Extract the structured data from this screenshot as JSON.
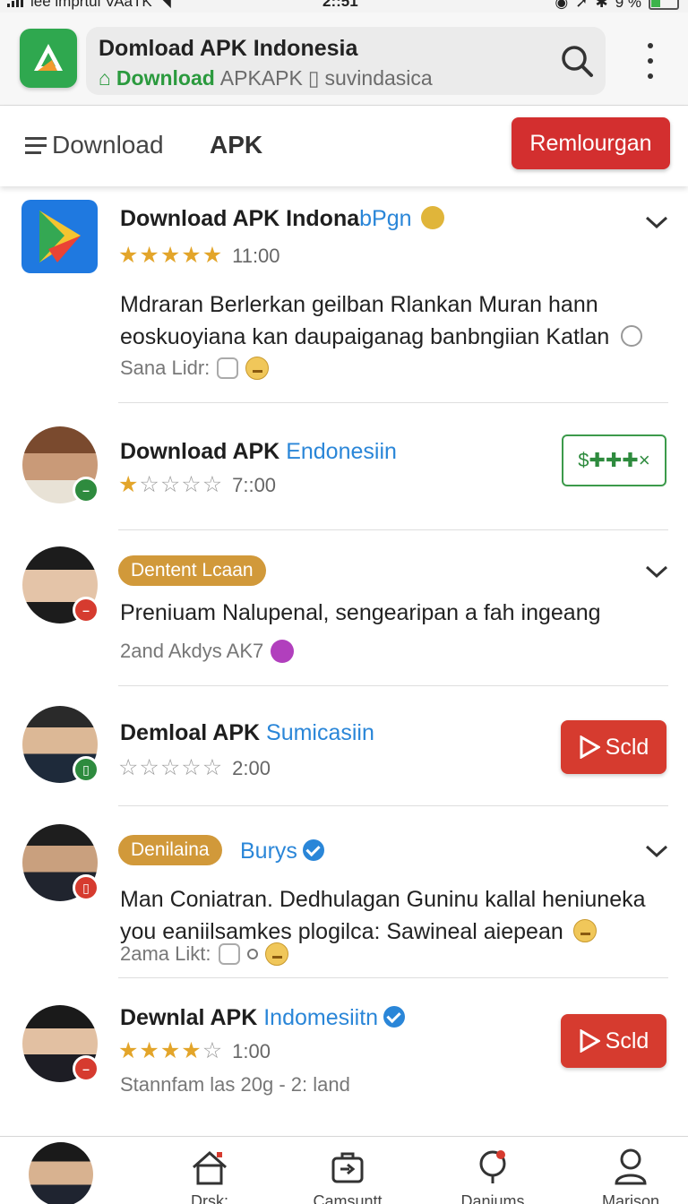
{
  "status": {
    "carrier": "lee imprtul VAaTK",
    "time": "2::51",
    "battery": "9 %"
  },
  "browser": {
    "title": "Domload APK Indonesia",
    "sub_green": "Download",
    "sub_rest": "APKAPK",
    "sub_domain": "suvindasica"
  },
  "topnav": {
    "download": "Download",
    "apk": "APK",
    "button": "Remlourgan"
  },
  "items": [
    {
      "name": "Download APK Indona",
      "name_blue": "bPgn",
      "rating": 5,
      "time": "11:00",
      "body": "Mdraran Berlerkan geilban Rlankan Muran hann eoskuoyiana kan daupaiganag banbngiian Katlan",
      "meta": "Sana Lidr:"
    },
    {
      "name": "Download APK",
      "name_blue": "Endonesiin",
      "rating": 1,
      "time": "7::00",
      "button": "$✚✚✚×"
    },
    {
      "tag": "Dentent Lcaan",
      "body": "Preniuam Nalupenal, sengearipan a fah ingeang",
      "meta": "2and Akdys  AK7"
    },
    {
      "name": "Demloal APK",
      "name_blue": "Sumicasiin",
      "rating": 0,
      "time": "2:00",
      "button": "Scld"
    },
    {
      "tag": "Denilaina",
      "name_blue": "Burys",
      "body": "Man Coniatran. Dedhulagan Guninu kallal heniuneka you eaniilsamkes plogilca: Sawineal aiepean",
      "meta": "2ama Likt:"
    },
    {
      "name": "Dewnlal APK",
      "name_blue": "Indomesiitn",
      "rating": 4,
      "time": "1:00",
      "meta": "Stannfam las 20g - 2: land",
      "button": "Scld"
    }
  ],
  "bottom_nav": [
    "Drsk:",
    "Camsuntt",
    "Daniums",
    "Marison"
  ],
  "colors": {
    "accent_red": "#d32f2f",
    "accent_blue": "#2a86d8",
    "star_gold": "#e3a52a",
    "brand_green": "#2fa84f"
  }
}
